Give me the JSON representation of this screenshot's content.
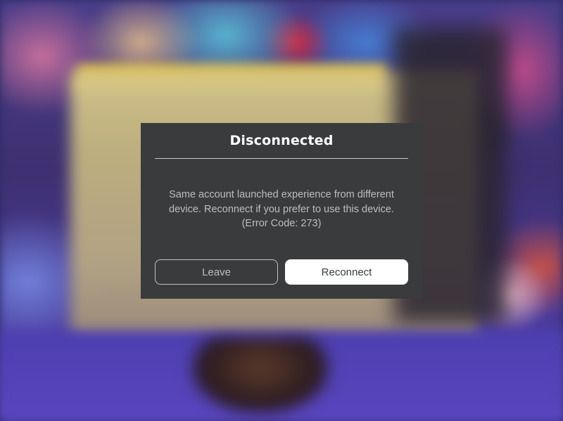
{
  "dialog": {
    "title": "Disconnected",
    "message_lines": [
      "Same account launched experience from different",
      "device. Reconnect if you prefer to use this device.",
      "(Error Code: 273)"
    ],
    "buttons": {
      "leave_label": "Leave",
      "reconnect_label": "Reconnect"
    }
  },
  "colors": {
    "dialog_background": "#393b3d",
    "title_text": "#ffffff",
    "message_text": "#bdbec0",
    "primary_button_bg": "#ffffff",
    "secondary_button_border": "#bfc1c3"
  }
}
